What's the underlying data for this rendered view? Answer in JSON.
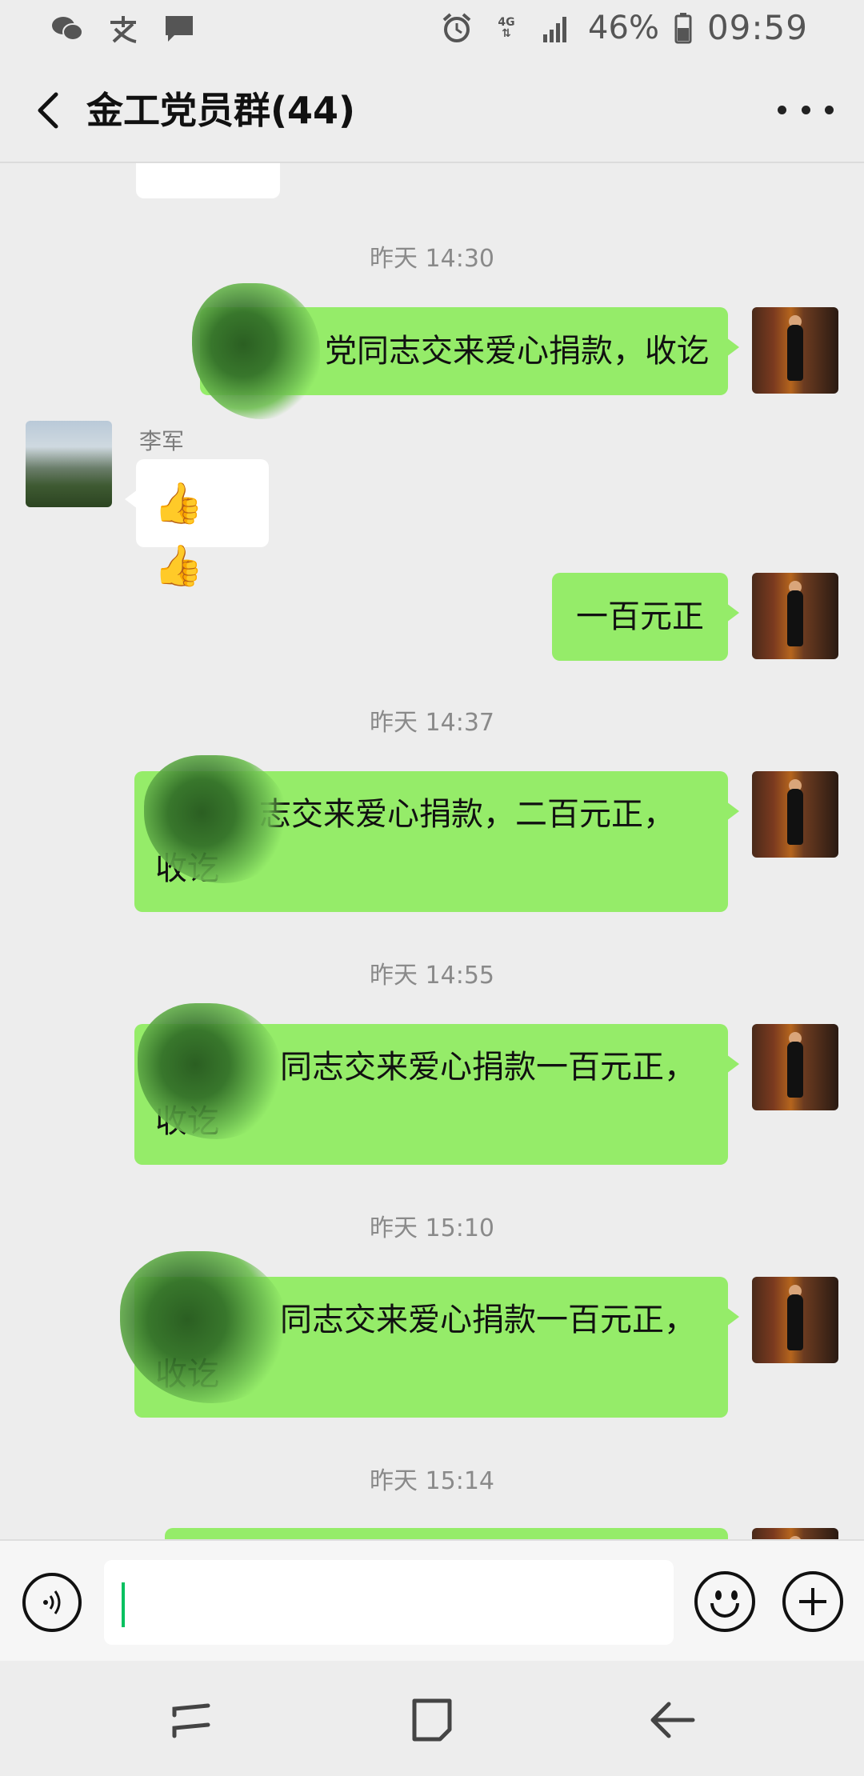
{
  "status_bar": {
    "battery": "46%",
    "time": "09:59",
    "network": "4G"
  },
  "header": {
    "title": "金工党员群(44)"
  },
  "messages": [
    {
      "timestamp": "昨天 14:30",
      "text": "党同志交来爱心捐款，收讫",
      "redacted_prefix": true
    },
    {
      "sender": "李军",
      "emoji": "👍👍"
    },
    {
      "text": "一百元正"
    },
    {
      "timestamp": "昨天 14:37",
      "text_line1": "志交来爱心捐款，二百元正，",
      "text_line2": "收讫",
      "redacted_prefix": true
    },
    {
      "timestamp": "昨天 14:55",
      "text_line1": "同志交来爱心捐款一百元正，",
      "text_line2": "收讫",
      "redacted_prefix": true
    },
    {
      "timestamp": "昨天 15:10",
      "text_line1": "同志交来爱心捐款一百元正，",
      "text_line2": "收讫",
      "redacted_prefix": true
    },
    {
      "timestamp": "昨天 15:14"
    }
  ],
  "input": {
    "value": ""
  },
  "colors": {
    "self_bubble": "#95ec69",
    "other_bubble": "#ffffff",
    "background": "#ededed",
    "cursor": "#07c160"
  }
}
